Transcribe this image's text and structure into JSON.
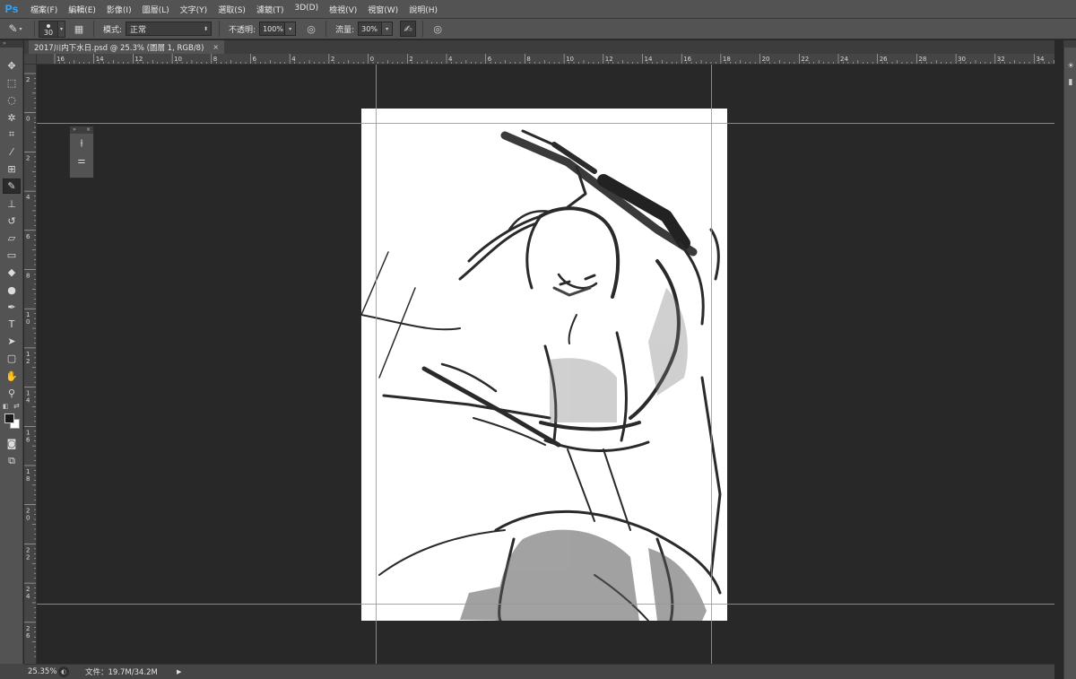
{
  "app": {
    "logo": "Ps",
    "accent": "#31a8ff",
    "guide_color": "#33c0d6"
  },
  "menu": [
    "檔案(F)",
    "編輯(E)",
    "影像(I)",
    "圖層(L)",
    "文字(Y)",
    "選取(S)",
    "濾鏡(T)",
    "3D(D)",
    "檢視(V)",
    "視窗(W)",
    "說明(H)"
  ],
  "options": {
    "brush_size": "30",
    "mode_label": "模式:",
    "mode_value": "正常",
    "opacity_label": "不透明:",
    "opacity_value": "100%",
    "flow_label": "流量:",
    "flow_value": "30%"
  },
  "document": {
    "tab_title": "2017川内下水日.psd @ 25.3% (圖層 1, RGB/8)",
    "close": "×"
  },
  "ruler": {
    "h_labels": [
      "16",
      "14",
      "12",
      "10",
      "8",
      "6",
      "4",
      "2",
      "0",
      "2",
      "4",
      "6",
      "8",
      "10",
      "12",
      "14",
      "16",
      "18",
      "20",
      "22",
      "24",
      "26",
      "28",
      "30",
      "32",
      "34"
    ],
    "v_labels": [
      "2",
      "0",
      "2",
      "4",
      "6",
      "8",
      "1\n0",
      "1\n2",
      "1\n4",
      "1\n6",
      "1\n8",
      "2\n0",
      "2\n2",
      "2\n4",
      "2\n6"
    ]
  },
  "float_panel": {
    "collapse": "»",
    "close": "×",
    "icons": [
      "brush-icon",
      "brush-settings-icon"
    ]
  },
  "tools": [
    {
      "name": "move-tool-icon",
      "glyph": "✥"
    },
    {
      "name": "marquee-tool-icon",
      "glyph": "⬚"
    },
    {
      "name": "lasso-tool-icon",
      "glyph": "◌"
    },
    {
      "name": "magic-wand-tool-icon",
      "glyph": "✲"
    },
    {
      "name": "crop-tool-icon",
      "glyph": "⌗"
    },
    {
      "name": "eyedropper-tool-icon",
      "glyph": "⁄"
    },
    {
      "name": "healing-brush-tool-icon",
      "glyph": "⊞"
    },
    {
      "name": "brush-tool-icon",
      "glyph": "✎"
    },
    {
      "name": "clone-stamp-tool-icon",
      "glyph": "⊥"
    },
    {
      "name": "history-brush-tool-icon",
      "glyph": "↺"
    },
    {
      "name": "eraser-tool-icon",
      "glyph": "▱"
    },
    {
      "name": "gradient-tool-icon",
      "glyph": "▭"
    },
    {
      "name": "blur-tool-icon",
      "glyph": "◆"
    },
    {
      "name": "dodge-tool-icon",
      "glyph": "●"
    },
    {
      "name": "pen-tool-icon",
      "glyph": "✒"
    },
    {
      "name": "type-tool-icon",
      "glyph": "T"
    },
    {
      "name": "path-selection-tool-icon",
      "glyph": "➤"
    },
    {
      "name": "shape-tool-icon",
      "glyph": "▢"
    },
    {
      "name": "hand-tool-icon",
      "glyph": "✋"
    },
    {
      "name": "zoom-tool-icon",
      "glyph": "⚲"
    }
  ],
  "status": {
    "zoom": "25.35%",
    "doc_size": "文件：19.7M/34.2M"
  }
}
